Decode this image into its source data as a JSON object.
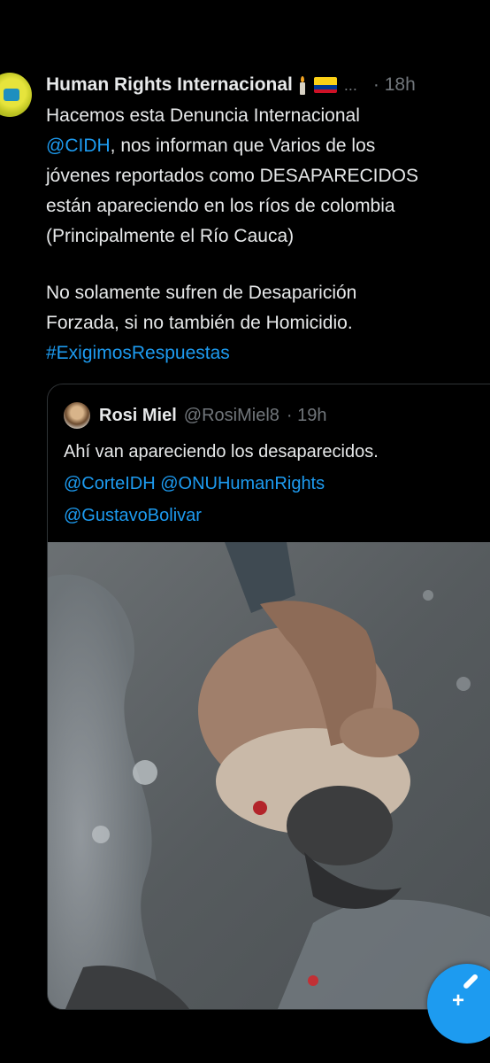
{
  "main_tweet": {
    "author_name": "Human Rights Internacional",
    "more": "...",
    "time": "· 18h",
    "flag_colors": [
      "#fcd116",
      "#003893",
      "#ce1126"
    ],
    "lines": {
      "l1": "Hacemos esta Denuncia Internacional",
      "l2_mention": "@CIDH",
      "l2_rest": ", nos informan que Varios de los",
      "l3": "jóvenes reportados como DESAPARECIDOS",
      "l4": "están apareciendo en los ríos de colombia",
      "l5": "(Principalmente el Río Cauca)",
      "l6": "No solamente sufren de Desaparición",
      "l7": "Forzada, si no también de Homicidio.",
      "hashtag": "#ExigimosRespuestas"
    }
  },
  "quoted_tweet": {
    "author_name": "Rosi Miel",
    "handle": "@RosiMiel8",
    "time": "· 19h",
    "lines": {
      "l1": "Ahí van apareciendo los desaparecidos.",
      "l2": "@CorteIDH @ONUHumanRights",
      "l3": "@GustavoBolivar"
    }
  },
  "compose": {
    "icon": "compose-feather-icon",
    "plus": "+"
  },
  "colors": {
    "background": "#000000",
    "text": "#e7e9ea",
    "secondary": "#71767b",
    "link": "#1d9bf0",
    "border": "#2f3336"
  }
}
